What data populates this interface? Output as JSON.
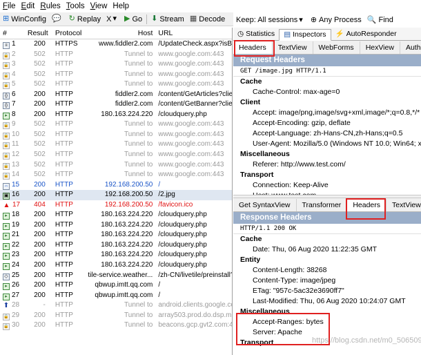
{
  "menu": [
    "File",
    "Edit",
    "Rules",
    "Tools",
    "View",
    "Help"
  ],
  "toolbar": {
    "winconfig": "WinConfig",
    "replay": "Replay",
    "remove": "X",
    "go": "Go",
    "stream": "Stream",
    "decode": "Decode"
  },
  "filter": {
    "keep": "Keep: All sessions",
    "process": "Any Process",
    "find": "Find"
  },
  "sessions": {
    "columns": [
      "#",
      "Result",
      "Protocol",
      "Host",
      "URL"
    ],
    "rows": [
      {
        "id": "1",
        "result": "200",
        "protocol": "HTTPS",
        "host": "www.fiddler2.com",
        "url": "/UpdateCheck.aspx?isBet",
        "style": "",
        "icon": "doc"
      },
      {
        "id": "2",
        "result": "502",
        "protocol": "HTTP",
        "host": "Tunnel to",
        "url": "www.google.com:443",
        "style": "gray",
        "icon": "lock"
      },
      {
        "id": "3",
        "result": "502",
        "protocol": "HTTP",
        "host": "Tunnel to",
        "url": "www.google.com:443",
        "style": "gray",
        "icon": "lock"
      },
      {
        "id": "4",
        "result": "502",
        "protocol": "HTTP",
        "host": "Tunnel to",
        "url": "www.google.com:443",
        "style": "gray",
        "icon": "lock"
      },
      {
        "id": "5",
        "result": "502",
        "protocol": "HTTP",
        "host": "Tunnel to",
        "url": "www.google.com:443",
        "style": "gray",
        "icon": "lock"
      },
      {
        "id": "6",
        "result": "200",
        "protocol": "HTTP",
        "host": "fiddler2.com",
        "url": "/content/GetArticles?clien",
        "style": "",
        "icon": "json"
      },
      {
        "id": "7",
        "result": "200",
        "protocol": "HTTP",
        "host": "fiddler2.com",
        "url": "/content/GetBanner?clien",
        "style": "",
        "icon": "json"
      },
      {
        "id": "8",
        "result": "200",
        "protocol": "HTTP",
        "host": "180.163.224.220",
        "url": "/cloudquery.php",
        "style": "",
        "icon": "green"
      },
      {
        "id": "9",
        "result": "502",
        "protocol": "HTTP",
        "host": "Tunnel to",
        "url": "www.google.com:443",
        "style": "gray",
        "icon": "lock"
      },
      {
        "id": "10",
        "result": "502",
        "protocol": "HTTP",
        "host": "Tunnel to",
        "url": "www.google.com:443",
        "style": "gray",
        "icon": "lock"
      },
      {
        "id": "11",
        "result": "502",
        "protocol": "HTTP",
        "host": "Tunnel to",
        "url": "www.google.com:443",
        "style": "gray",
        "icon": "lock"
      },
      {
        "id": "12",
        "result": "502",
        "protocol": "HTTP",
        "host": "Tunnel to",
        "url": "www.google.com:443",
        "style": "gray",
        "icon": "lock"
      },
      {
        "id": "13",
        "result": "502",
        "protocol": "HTTP",
        "host": "Tunnel to",
        "url": "www.google.com:443",
        "style": "gray",
        "icon": "lock"
      },
      {
        "id": "14",
        "result": "502",
        "protocol": "HTTP",
        "host": "Tunnel to",
        "url": "www.google.com:443",
        "style": "gray",
        "icon": "lock"
      },
      {
        "id": "15",
        "result": "200",
        "protocol": "HTTP",
        "host": "192.168.200.50",
        "url": "/",
        "style": "blue",
        "icon": "arrows"
      },
      {
        "id": "16",
        "result": "200",
        "protocol": "HTTP",
        "host": "192.168.200.50",
        "url": "/2.jpg",
        "style": "sel",
        "icon": "img"
      },
      {
        "id": "17",
        "result": "404",
        "protocol": "HTTP",
        "host": "192.168.200.50",
        "url": "/favicon.ico",
        "style": "red",
        "icon": "warn"
      },
      {
        "id": "18",
        "result": "200",
        "protocol": "HTTP",
        "host": "180.163.224.220",
        "url": "/cloudquery.php",
        "style": "",
        "icon": "green"
      },
      {
        "id": "19",
        "result": "200",
        "protocol": "HTTP",
        "host": "180.163.224.220",
        "url": "/cloudquery.php",
        "style": "",
        "icon": "green"
      },
      {
        "id": "21",
        "result": "200",
        "protocol": "HTTP",
        "host": "180.163.224.220",
        "url": "/cloudquery.php",
        "style": "",
        "icon": "green"
      },
      {
        "id": "22",
        "result": "200",
        "protocol": "HTTP",
        "host": "180.163.224.220",
        "url": "/cloudquery.php",
        "style": "",
        "icon": "green"
      },
      {
        "id": "23",
        "result": "200",
        "protocol": "HTTP",
        "host": "180.163.224.220",
        "url": "/cloudquery.php",
        "style": "",
        "icon": "green"
      },
      {
        "id": "24",
        "result": "200",
        "protocol": "HTTP",
        "host": "180.163.224.220",
        "url": "/cloudquery.php",
        "style": "",
        "icon": "green"
      },
      {
        "id": "25",
        "result": "200",
        "protocol": "HTTP",
        "host": "tile-service.weather...",
        "url": "/zh-CN/livetile/preinstall?r",
        "style": "",
        "icon": "html"
      },
      {
        "id": "26",
        "result": "200",
        "protocol": "HTTP",
        "host": "qbwup.imtt.qq.com",
        "url": "/",
        "style": "",
        "icon": "green"
      },
      {
        "id": "27",
        "result": "200",
        "protocol": "HTTP",
        "host": "qbwup.imtt.qq.com",
        "url": "/",
        "style": "",
        "icon": "green"
      },
      {
        "id": "28",
        "result": "-",
        "protocol": "HTTP",
        "host": "Tunnel to",
        "url": "android.clients.google.co",
        "style": "gray",
        "icon": "up"
      },
      {
        "id": "29",
        "result": "200",
        "protocol": "HTTP",
        "host": "Tunnel to",
        "url": "array503.prod.do.dsp.mp",
        "style": "gray",
        "icon": "lock"
      },
      {
        "id": "30",
        "result": "200",
        "protocol": "HTTP",
        "host": "Tunnel to",
        "url": "beacons.gcp.gvt2.com:44",
        "style": "gray",
        "icon": "lock"
      }
    ]
  },
  "inspector_tabs": [
    "Statistics",
    "Inspectors",
    "AutoResponder"
  ],
  "request": {
    "tabs": [
      "Headers",
      "TextView",
      "WebForms",
      "HexView",
      "Auth"
    ],
    "section_title": "Request Headers",
    "request_line": "GET /image.jpg HTTP/1.1",
    "groups": [
      {
        "name": "Cache",
        "items": [
          "Cache-Control: max-age=0"
        ]
      },
      {
        "name": "Client",
        "items": [
          "Accept: image/png,image/svg+xml,image/*;q=0.8,*/*",
          "Accept-Encoding: gzip, deflate",
          "Accept-Language: zh-Hans-CN,zh-Hans;q=0.5",
          "User-Agent: Mozilla/5.0 (Windows NT 10.0; Win64; x6"
        ]
      },
      {
        "name": "Miscellaneous",
        "items": [
          "Referer: http://www.test.com/"
        ]
      },
      {
        "name": "Transport",
        "items": [
          "Connection: Keep-Alive",
          "Host: www.test.com"
        ]
      }
    ]
  },
  "response": {
    "tabs": [
      "Get SyntaxView",
      "Transformer",
      "Headers",
      "TextView"
    ],
    "section_title": "Response Headers",
    "status_line": "HTTP/1.1 200 OK",
    "groups": [
      {
        "name": "Cache",
        "items": [
          "Date: Thu, 06 Aug 2020 11:22:35 GMT"
        ]
      },
      {
        "name": "Entity",
        "items": [
          "Content-Length: 38268",
          "Content-Type: image/jpeg",
          "ETag: \"957c-5ac32e3690ff7\"",
          "Last-Modified: Thu, 06 Aug 2020 10:24:07 GMT"
        ]
      },
      {
        "name": "Miscellaneous",
        "items": [
          "Accept-Ranges: bytes",
          "Server: Apache"
        ]
      },
      {
        "name": "Transport",
        "items": []
      }
    ]
  },
  "watermark": "https://blog.csdn.net/m0_50650953",
  "colors": {
    "section_header": "#9aaec9",
    "highlight_box": "#e02020",
    "selected_row": "#dfe7f1",
    "link_blue": "#1a55c8",
    "error_red": "#e01010"
  }
}
